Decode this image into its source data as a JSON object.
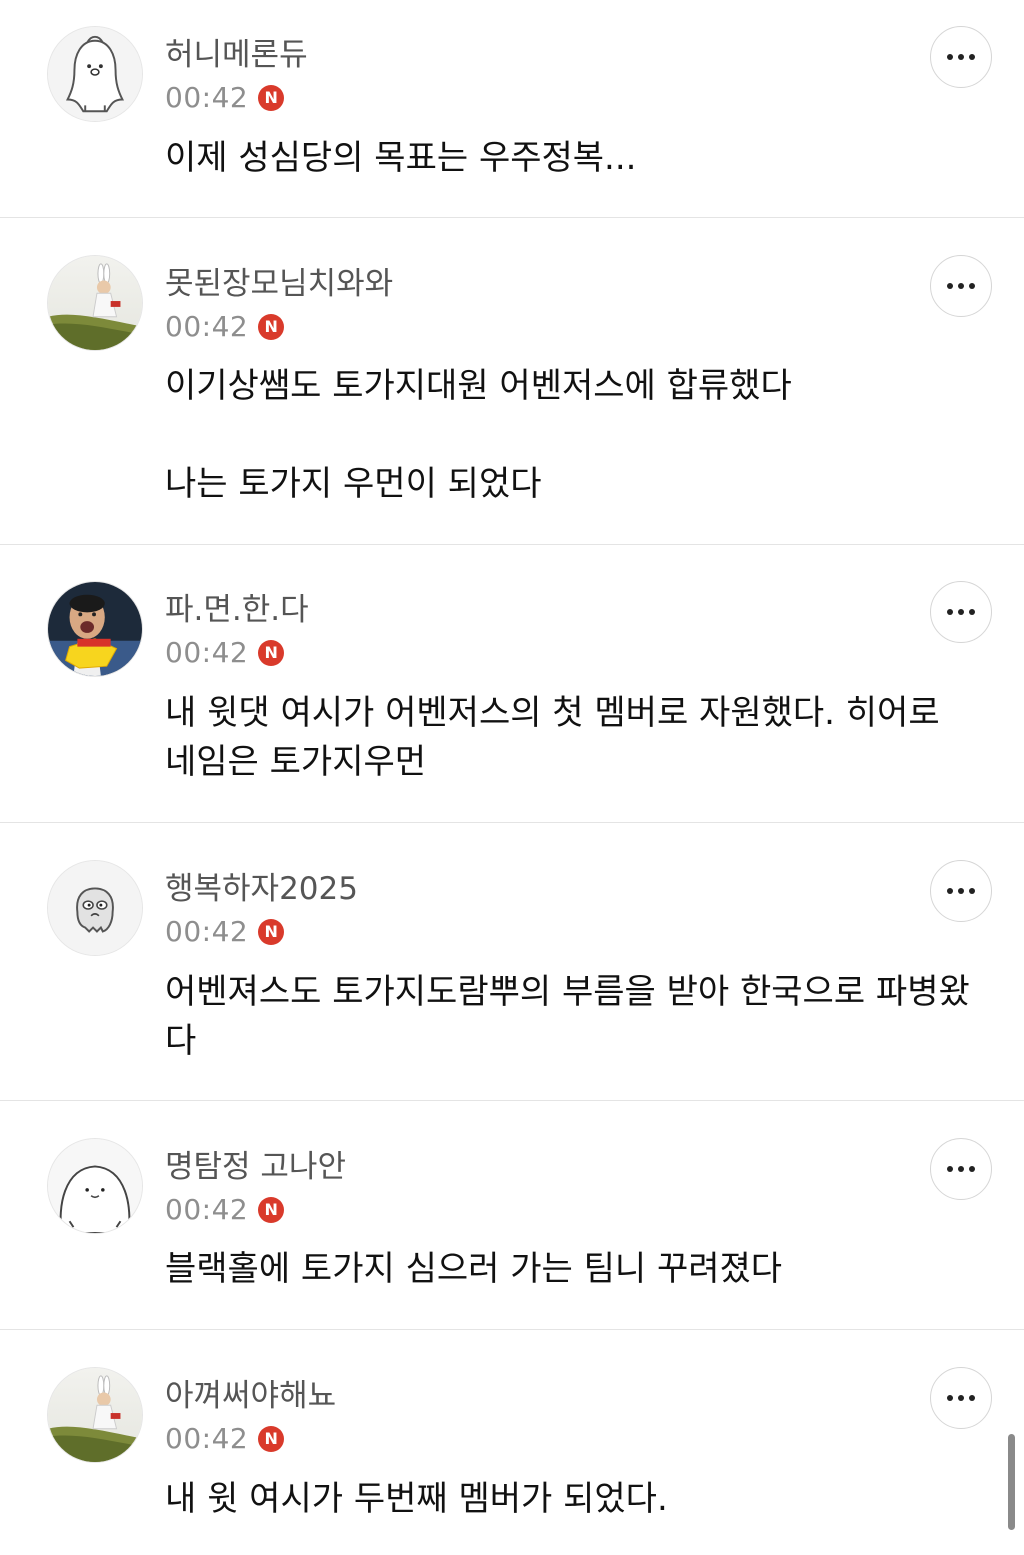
{
  "comments": [
    {
      "nickname": "허니메론듀",
      "time": "00:42",
      "badge": "N",
      "text": "이제 성심당의 목표는 우주정복...",
      "avatar": "penguin-avatar",
      "more": "more-options-icon"
    },
    {
      "nickname": "못된장모님치와와",
      "time": "00:42",
      "badge": "N",
      "text": "이기상쌤도 토가지대원 어벤저스에 합류했다\n\n나는 토가지 우먼이 되었다",
      "avatar": "bunny-costume-photo-avatar",
      "more": "more-options-icon"
    },
    {
      "nickname": "파.면.한.다",
      "time": "00:42",
      "badge": "N",
      "text": "내 윗댓 여시가 어벤저스의 첫 멤버로 자원했다. 히어로 네임은 토가지우먼",
      "avatar": "shouting-man-photo-avatar",
      "more": "more-options-icon"
    },
    {
      "nickname": "행복하자2025",
      "time": "00:42",
      "badge": "N",
      "text": "어벤져스도 토가지도람뿌의 부름을 받아 한국으로 파병왔다",
      "avatar": "ghost-avatar",
      "more": "more-options-icon"
    },
    {
      "nickname": "명탐정 고나안",
      "time": "00:42",
      "badge": "N",
      "text": "블랙홀에 토가지 심으러 가는 팀니 꾸려졌다",
      "avatar": "seal-avatar",
      "more": "more-options-icon"
    },
    {
      "nickname": "아껴써야해뇨",
      "time": "00:42",
      "badge": "N",
      "text": "내 윗 여시가 두번째 멤버가 되었다.",
      "avatar": "bunny-costume-photo-avatar",
      "more": "more-options-icon"
    }
  ],
  "colors": {
    "badge": "#d93a2b",
    "nickname": "#555555",
    "time": "#8e8e8e",
    "divider": "#e4e4e4"
  }
}
